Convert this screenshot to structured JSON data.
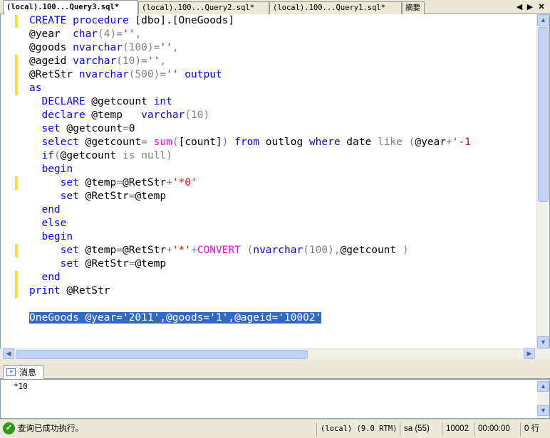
{
  "tabs": [
    {
      "label": "(local).100...Query3.sql*",
      "active": true
    },
    {
      "label": "(local).100...Query2.sql*",
      "active": false
    },
    {
      "label": "(local).100...Query1.sql*",
      "active": false
    },
    {
      "label": "摘要",
      "active": false
    }
  ],
  "tab_controls": {
    "prev_icon": "triangle-left-icon",
    "next_icon": "triangle-right-icon",
    "close_icon": "close-icon"
  },
  "editor": {
    "lines": [
      [
        {
          "t": "CREATE",
          "c": "kw"
        },
        {
          "t": " "
        },
        {
          "t": "procedure",
          "c": "kw"
        },
        {
          "t": " [dbo].[OneGoods]"
        }
      ],
      [
        {
          "t": "@year  "
        },
        {
          "t": "char",
          "c": "kw"
        },
        {
          "t": "(4)",
          "c": "op"
        },
        {
          "t": "=",
          "c": "op"
        },
        {
          "t": "''",
          "c": "str"
        },
        {
          "t": ",",
          "c": "op"
        }
      ],
      [
        {
          "t": "@goods "
        },
        {
          "t": "nvarchar",
          "c": "kw"
        },
        {
          "t": "(100)",
          "c": "op"
        },
        {
          "t": "=",
          "c": "op"
        },
        {
          "t": "''",
          "c": "str"
        },
        {
          "t": ",",
          "c": "op"
        }
      ],
      [
        {
          "t": "@ageid "
        },
        {
          "t": "varchar",
          "c": "kw"
        },
        {
          "t": "(10)",
          "c": "op"
        },
        {
          "t": "=",
          "c": "op"
        },
        {
          "t": "''",
          "c": "str"
        },
        {
          "t": ",",
          "c": "op"
        }
      ],
      [
        {
          "t": "@RetStr "
        },
        {
          "t": "nvarchar",
          "c": "kw"
        },
        {
          "t": "(500)",
          "c": "op"
        },
        {
          "t": "=",
          "c": "op"
        },
        {
          "t": "''",
          "c": "str"
        },
        {
          "t": " "
        },
        {
          "t": "output",
          "c": "kw"
        }
      ],
      [
        {
          "t": "as",
          "c": "kw"
        }
      ],
      [
        {
          "t": "  "
        },
        {
          "t": "DECLARE",
          "c": "kw"
        },
        {
          "t": " @getcount "
        },
        {
          "t": "int",
          "c": "kw"
        }
      ],
      [
        {
          "t": "  "
        },
        {
          "t": "declare",
          "c": "kw"
        },
        {
          "t": " @temp   "
        },
        {
          "t": "varchar",
          "c": "kw"
        },
        {
          "t": "(10)",
          "c": "op"
        }
      ],
      [
        {
          "t": "  "
        },
        {
          "t": "set",
          "c": "kw"
        },
        {
          "t": " @getcount"
        },
        {
          "t": "=",
          "c": "op"
        },
        {
          "t": "0"
        }
      ],
      [
        {
          "t": "  "
        },
        {
          "t": "select",
          "c": "kw"
        },
        {
          "t": " @getcount"
        },
        {
          "t": "=",
          "c": "op"
        },
        {
          "t": " "
        },
        {
          "t": "sum",
          "c": "fn"
        },
        {
          "t": "(",
          "c": "op"
        },
        {
          "t": "[count]"
        },
        {
          "t": ")",
          "c": "op"
        },
        {
          "t": " "
        },
        {
          "t": "from",
          "c": "kw"
        },
        {
          "t": " outlog "
        },
        {
          "t": "where",
          "c": "kw"
        },
        {
          "t": " date "
        },
        {
          "t": "like",
          "c": "op"
        },
        {
          "t": " "
        },
        {
          "t": "(",
          "c": "op"
        },
        {
          "t": "@year"
        },
        {
          "t": "+",
          "c": "op"
        },
        {
          "t": "'-1",
          "c": "str"
        }
      ],
      [
        {
          "t": "  "
        },
        {
          "t": "if",
          "c": "kw"
        },
        {
          "t": "(",
          "c": "op"
        },
        {
          "t": "@getcount "
        },
        {
          "t": "is",
          "c": "op"
        },
        {
          "t": " "
        },
        {
          "t": "null",
          "c": "op"
        },
        {
          "t": ")",
          "c": "op"
        }
      ],
      [
        {
          "t": "  "
        },
        {
          "t": "begin",
          "c": "kw"
        }
      ],
      [
        {
          "t": "     "
        },
        {
          "t": "set",
          "c": "kw"
        },
        {
          "t": " @temp"
        },
        {
          "t": "=",
          "c": "op"
        },
        {
          "t": "@RetStr"
        },
        {
          "t": "+",
          "c": "op"
        },
        {
          "t": "'*0'",
          "c": "str"
        }
      ],
      [
        {
          "t": "     "
        },
        {
          "t": "set",
          "c": "kw"
        },
        {
          "t": " @RetStr"
        },
        {
          "t": "=",
          "c": "op"
        },
        {
          "t": "@temp"
        }
      ],
      [
        {
          "t": "  "
        },
        {
          "t": "end",
          "c": "kw"
        }
      ],
      [
        {
          "t": "  "
        },
        {
          "t": "else",
          "c": "kw"
        }
      ],
      [
        {
          "t": "  "
        },
        {
          "t": "begin",
          "c": "kw"
        }
      ],
      [
        {
          "t": "     "
        },
        {
          "t": "set",
          "c": "kw"
        },
        {
          "t": " @temp"
        },
        {
          "t": "=",
          "c": "op"
        },
        {
          "t": "@RetStr"
        },
        {
          "t": "+",
          "c": "op"
        },
        {
          "t": "'*'",
          "c": "str"
        },
        {
          "t": "+",
          "c": "op"
        },
        {
          "t": "CONVERT",
          "c": "fn"
        },
        {
          "t": " "
        },
        {
          "t": "(",
          "c": "op"
        },
        {
          "t": "nvarchar",
          "c": "kw"
        },
        {
          "t": "(100)",
          "c": "op"
        },
        {
          "t": ",",
          "c": "op"
        },
        {
          "t": "@getcount "
        },
        {
          "t": ")",
          "c": "op"
        }
      ],
      [
        {
          "t": "     "
        },
        {
          "t": "set",
          "c": "kw"
        },
        {
          "t": " @RetStr"
        },
        {
          "t": "=",
          "c": "op"
        },
        {
          "t": "@temp"
        }
      ],
      [
        {
          "t": "  "
        },
        {
          "t": "end",
          "c": "kw"
        }
      ],
      [
        {
          "t": "print",
          "c": "kw"
        },
        {
          "t": " @RetStr"
        }
      ],
      [],
      [
        {
          "t": "OneGoods @year='2011',@goods='1',@ageid='10002'",
          "c": "sel"
        }
      ]
    ],
    "changed_line_markers": [
      0,
      3,
      4,
      5,
      12,
      17,
      19,
      20
    ]
  },
  "scroll": {
    "up_icon": "arrow-up-icon",
    "down_icon": "arrow-down-icon",
    "left_icon": "arrow-left-icon",
    "right_icon": "arrow-right-icon"
  },
  "messages": {
    "tab_label": "消息",
    "text": "*10"
  },
  "status": {
    "message": "查询已成功执行。",
    "server": "(local) (9.0 RTM)",
    "user": "sa (55)",
    "database": "10002",
    "elapsed": "00:00:00",
    "rows": "0 行"
  }
}
